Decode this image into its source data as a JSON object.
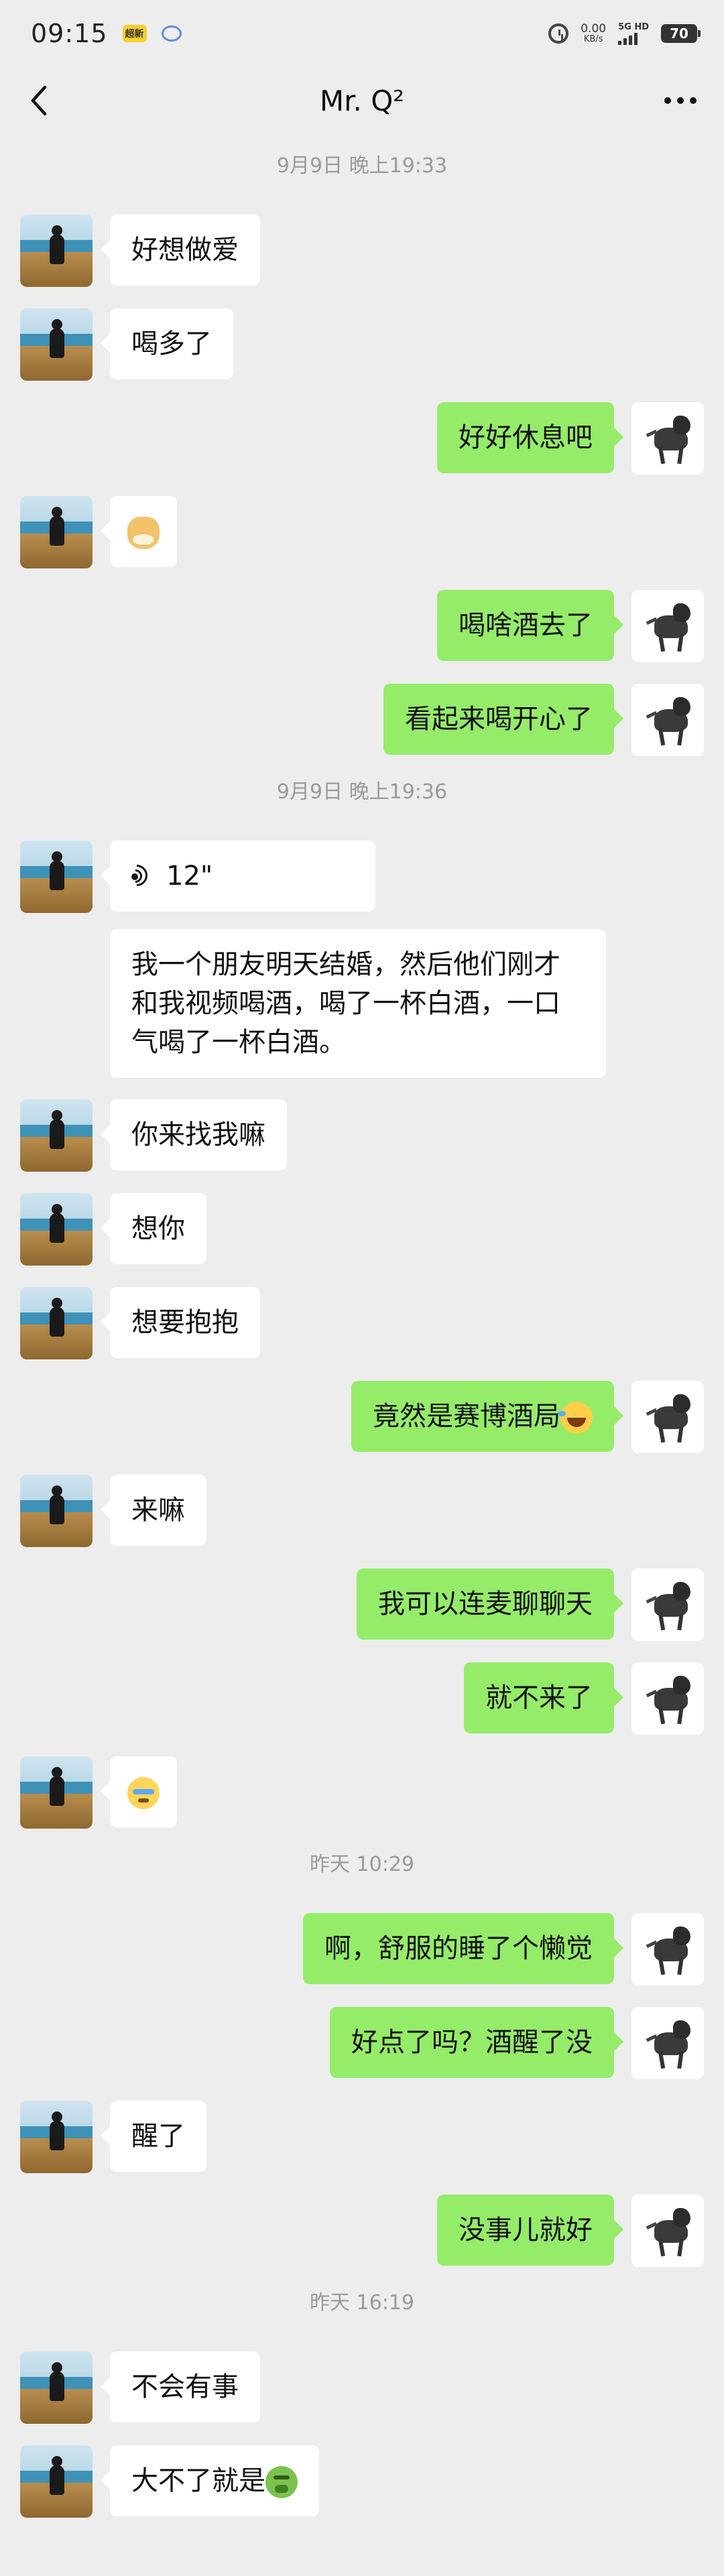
{
  "status_bar": {
    "time": "09:15",
    "notif_badge": "超新",
    "net_speed_value": "0.00",
    "net_speed_unit": "KB/s",
    "network_tag": "5G HD",
    "battery": "70"
  },
  "header": {
    "title": "Mr. Q²",
    "back_icon": "chevron-left-icon",
    "more_icon": "more-dots-icon"
  },
  "colors": {
    "background": "#ededed",
    "sent_bubble": "#95ec69",
    "received_bubble": "#ffffff",
    "timestamp_text": "#9a9a9a"
  },
  "messages": [
    {
      "type": "time",
      "text": "9月9日 晚上19:33"
    },
    {
      "type": "msg",
      "side": "left",
      "text": "好想做爱"
    },
    {
      "type": "msg",
      "side": "left",
      "text": "喝多了"
    },
    {
      "type": "msg",
      "side": "right",
      "text": "好好休息吧"
    },
    {
      "type": "msg",
      "side": "left",
      "text": "",
      "emoji": "doge-emoji"
    },
    {
      "type": "msg",
      "side": "right",
      "text": "喝啥酒去了"
    },
    {
      "type": "msg",
      "side": "right",
      "text": "看起来喝开心了"
    },
    {
      "type": "time",
      "text": "9月9日 晚上19:36"
    },
    {
      "type": "voice",
      "side": "left",
      "duration": "12\"",
      "transcript": "我一个朋友明天结婚，然后他们刚才和我视频喝酒，喝了一杯白酒，一口气喝了一杯白酒。"
    },
    {
      "type": "msg",
      "side": "left",
      "text": "你来找我嘛"
    },
    {
      "type": "msg",
      "side": "left",
      "text": "想你"
    },
    {
      "type": "msg",
      "side": "left",
      "text": "想要抱抱"
    },
    {
      "type": "msg",
      "side": "right",
      "text": "竟然是赛博酒局",
      "emoji": "laugh-cry-emoji"
    },
    {
      "type": "msg",
      "side": "left",
      "text": "来嘛"
    },
    {
      "type": "msg",
      "side": "right",
      "text": "我可以连麦聊聊天"
    },
    {
      "type": "msg",
      "side": "right",
      "text": "就不来了"
    },
    {
      "type": "msg",
      "side": "left",
      "text": "",
      "emoji": "teary-emoji"
    },
    {
      "type": "time",
      "text": "昨天 10:29"
    },
    {
      "type": "msg",
      "side": "right",
      "text": "啊，舒服的睡了个懒觉"
    },
    {
      "type": "msg",
      "side": "right",
      "text": "好点了吗？酒醒了没"
    },
    {
      "type": "msg",
      "side": "left",
      "text": "醒了"
    },
    {
      "type": "msg",
      "side": "right",
      "text": "没事儿就好"
    },
    {
      "type": "time",
      "text": "昨天 16:19"
    },
    {
      "type": "msg",
      "side": "left",
      "text": "不会有事"
    },
    {
      "type": "msg",
      "side": "left",
      "text": "大不了就是",
      "emoji": "nauseated-emoji"
    }
  ]
}
